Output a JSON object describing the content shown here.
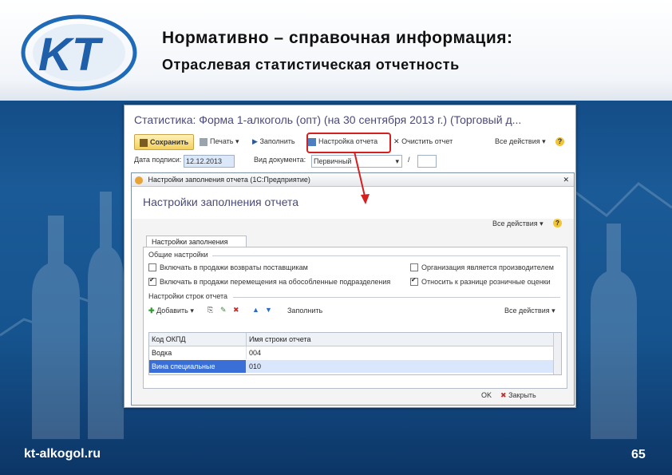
{
  "slide": {
    "title": "Нормативно – справочная информация:",
    "subtitle": "Отраслевая  статистическая отчетность",
    "footer_site": "kt-alkogol.ru",
    "page_number": "65",
    "logo_text": "KT"
  },
  "window": {
    "title": "Статистика: Форма 1-алкоголь (опт) (на 30 сентября 2013 г.) (Торговый д...",
    "toolbar": {
      "save": "Сохранить",
      "print": "Печать",
      "fill": "Заполнить",
      "report_settings": "Настройка отчета",
      "clear": "Очистить отчет",
      "all_actions": "Все действия",
      "help": "?"
    },
    "row2": {
      "date_label": "Дата подписи:",
      "date_value": "12.12.2013",
      "doctype_label": "Вид документа:",
      "doctype_value": "Первичный",
      "slash": "/"
    }
  },
  "dialog": {
    "titlebar": "Настройки заполнения отчета  (1С:Предприятие)",
    "heading": "Настройки заполнения отчета",
    "all_actions": "Все действия",
    "tab": "Настройки заполнения",
    "general_group": "Общие настройки",
    "checkboxes": [
      {
        "label": "Включать в продажи возвраты поставщикам",
        "checked": false
      },
      {
        "label": "Организация является производителем",
        "checked": false
      },
      {
        "label": "Включать в продажи перемещения на обособленные подразделения",
        "checked": true
      },
      {
        "label": "Относить к разнице розничные оценки",
        "checked": true
      }
    ],
    "rows_group": "Настройки строк отчета",
    "grid_toolbar": {
      "add": "Добавить",
      "fill": "Заполнить",
      "all_actions": "Все действия"
    },
    "grid": {
      "headers": [
        "Код ОКПД",
        "Имя строки отчета"
      ],
      "rows": [
        [
          "Водка",
          "004"
        ],
        [
          "Вина специальные",
          "010"
        ]
      ]
    },
    "ok": "OK",
    "close": "Закрыть"
  },
  "colors": {
    "slide_bg": "#16548f",
    "highlight": "#d42020",
    "selected_row": "#3a6fd8"
  }
}
